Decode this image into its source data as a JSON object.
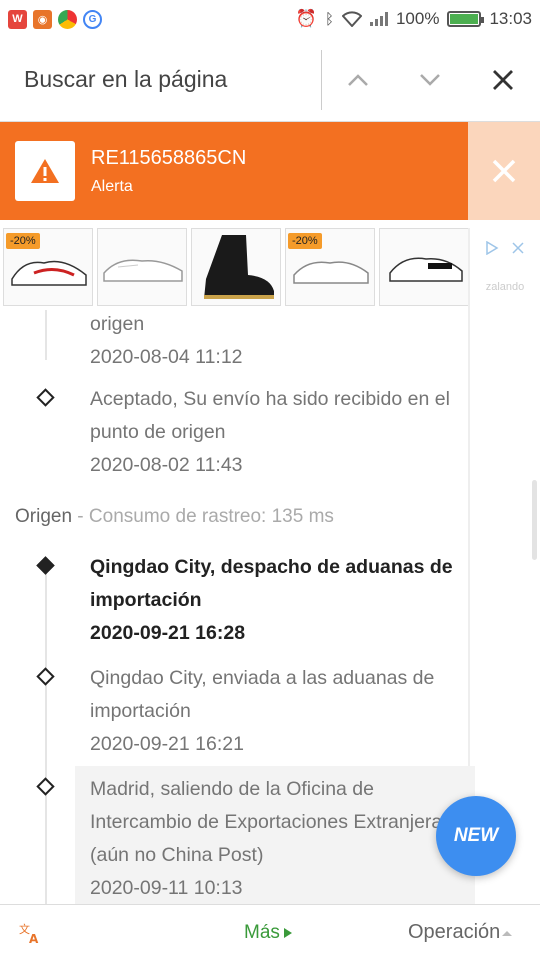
{
  "status_bar": {
    "battery": "100%",
    "time": "13:03",
    "app_icons": [
      "wps-icon",
      "orange-app-icon",
      "chrome-icon",
      "google-icon"
    ]
  },
  "find_bar": {
    "placeholder": "Buscar en la página"
  },
  "alert": {
    "tracking_number": "RE115658865CN",
    "label": "Alerta",
    "color": "#f37021"
  },
  "ads": {
    "items": [
      {
        "badge": "-20%"
      },
      {
        "badge": ""
      },
      {
        "badge": ""
      },
      {
        "badge": "-20%"
      },
      {
        "badge": ""
      }
    ],
    "brand": "zalando"
  },
  "timeline_top": [
    {
      "text": "origen",
      "time": "2020-08-04 11:12"
    },
    {
      "text": "Aceptado, Su envío ha sido recibido en el punto de origen",
      "time": "2020-08-02 11:43"
    }
  ],
  "section": {
    "name": "Origen",
    "meta": " - Consumo de rastreo: 135 ms"
  },
  "timeline_origin": [
    {
      "text": "Qingdao City, despacho de aduanas de importación",
      "time": "2020-09-21 16:28"
    },
    {
      "text": "Qingdao City, enviada a las aduanas de importación",
      "time": "2020-09-21 16:21"
    },
    {
      "text": "Madrid, saliendo de la Oficina de Intercambio de Exportaciones Extranjeras (aún no China Post)",
      "time": "2020-09-11 10:13"
    }
  ],
  "new_badge": "NEW",
  "bottom_bar": {
    "more": "Más",
    "operations": "Operación"
  }
}
